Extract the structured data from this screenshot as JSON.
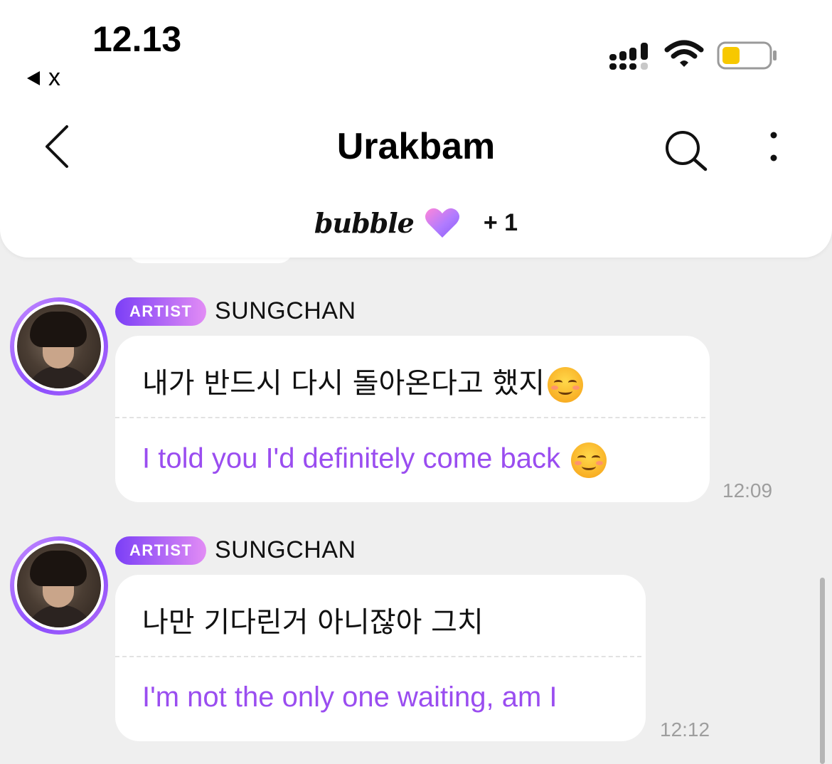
{
  "status_bar": {
    "time": "12.13",
    "back_app": "x"
  },
  "header": {
    "title": "Urakbam",
    "bubble_logo": "bubble",
    "plus_count": "+ 1"
  },
  "messages": [
    {
      "badge": "ARTIST",
      "sender": "SUNGCHAN",
      "korean": "내가 반드시 다시 돌아온다고 했지",
      "translation": "I told you I'd definitely come back",
      "time": "12:09"
    },
    {
      "badge": "ARTIST",
      "sender": "SUNGCHAN",
      "korean": "나만 기다린거 아니잖아 그치",
      "translation": "I'm not the only one waiting, am I",
      "time": "12:12"
    }
  ],
  "colors": {
    "accent": "#9a4df0",
    "badge_gradient_start": "#7b3ff6",
    "badge_gradient_end": "#e28cf5",
    "background": "#efefef",
    "battery_fill": "#f7c800"
  },
  "icons": [
    "back-triangle-icon",
    "cellular-signal-icon",
    "wifi-icon",
    "battery-icon",
    "back-chevron-icon",
    "search-icon",
    "more-vertical-icon",
    "heart-icon",
    "smiling-emoji-icon"
  ]
}
